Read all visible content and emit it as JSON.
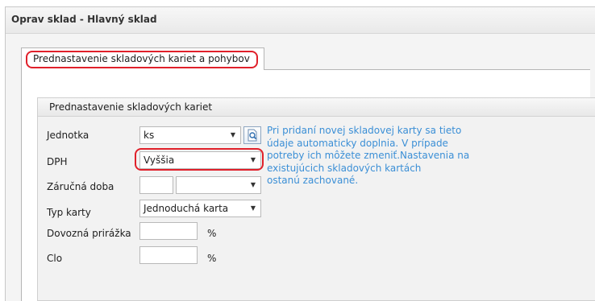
{
  "window": {
    "title": "Oprav sklad - Hlavný sklad"
  },
  "tabs": [
    {
      "label": "Prednastavenie skladových kariet a pohybov",
      "active": true
    }
  ],
  "group": {
    "title": "Prednastavenie skladových kariet",
    "fields": {
      "jednotka": {
        "label": "Jednotka",
        "value": "ks"
      },
      "dph": {
        "label": "DPH",
        "value": "Vyššia"
      },
      "zarucna_doba": {
        "label": "Záručná doba",
        "value": "",
        "unit_value": ""
      },
      "typ_karty": {
        "label": "Typ karty",
        "value": "Jednoduchá karta"
      },
      "dovozna_prirazka": {
        "label": "Dovozná prirážka",
        "value": "",
        "unit": "%"
      },
      "clo": {
        "label": "Clo",
        "value": "",
        "unit": "%"
      }
    },
    "info_lines": [
      "Pri pridaní novej skladovej karty sa tieto",
      "údaje automaticky doplnia. V prípade",
      "potreby ich môžete zmeniť.Nastavenia na",
      "existujúcich skladových kartách",
      "ostanú zachované."
    ]
  },
  "colors": {
    "highlight": "#e0202a",
    "info_text": "#3b8fd6"
  }
}
